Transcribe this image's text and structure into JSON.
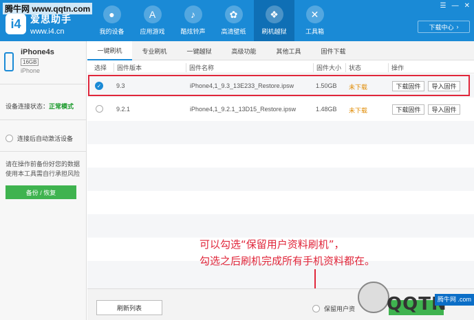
{
  "watermark_top": "腾牛网 www.qqtn.com",
  "app": {
    "logo_mark": "i4",
    "name": "爱思助手",
    "url": "www.i4.cn"
  },
  "nav": [
    {
      "label": "我的设备",
      "icon": "apple-icon"
    },
    {
      "label": "应用游戏",
      "icon": "appstore-icon"
    },
    {
      "label": "酷炫铃声",
      "icon": "bell-icon"
    },
    {
      "label": "高清壁纸",
      "icon": "flower-icon"
    },
    {
      "label": "刷机越狱",
      "icon": "box-icon"
    },
    {
      "label": "工具箱",
      "icon": "tools-icon"
    }
  ],
  "download_center": "下载中心",
  "device": {
    "name": "iPhone4s",
    "capacity": "16GB",
    "type": "iPhone"
  },
  "connection": {
    "label": "设备连接状态：",
    "value": "正常模式"
  },
  "auto_activate": "连接后自动激活设备",
  "warning": "请在操作前备份好您的数据 使用本工具需自行承担风险",
  "backup_btn": "备份 / 恢复",
  "tabs": [
    "一键刷机",
    "专业刷机",
    "一键越狱",
    "高级功能",
    "其他工具",
    "固件下载"
  ],
  "table": {
    "headers": {
      "select": "选择",
      "version": "固件版本",
      "name": "固件名称",
      "size": "固件大小",
      "status": "状态",
      "action": "操作"
    },
    "rows": [
      {
        "version": "9.3",
        "name": "iPhone4,1_9.3_13E233_Restore.ipsw",
        "size": "1.50GB",
        "status": "未下载",
        "download": "下载固件",
        "import": "导入固件",
        "selected": true
      },
      {
        "version": "9.2.1",
        "name": "iPhone4,1_9.2.1_13D15_Restore.ipsw",
        "size": "1.48GB",
        "status": "未下载",
        "download": "下载固件",
        "import": "导入固件",
        "selected": false
      }
    ]
  },
  "annotation": {
    "line1": "可以勾选“保留用户资料刷机”，",
    "line2": "勾选之后刷机完成所有手机资料都在。"
  },
  "bottom": {
    "refresh": "刷新列表",
    "keep_data": "保留用户资"
  },
  "qqtn": {
    "text": "QQTN",
    "badge": "腾牛网 .com"
  },
  "colors": {
    "primary": "#1a8ad6",
    "green": "#3fb34f",
    "highlight": "#e0263a"
  }
}
